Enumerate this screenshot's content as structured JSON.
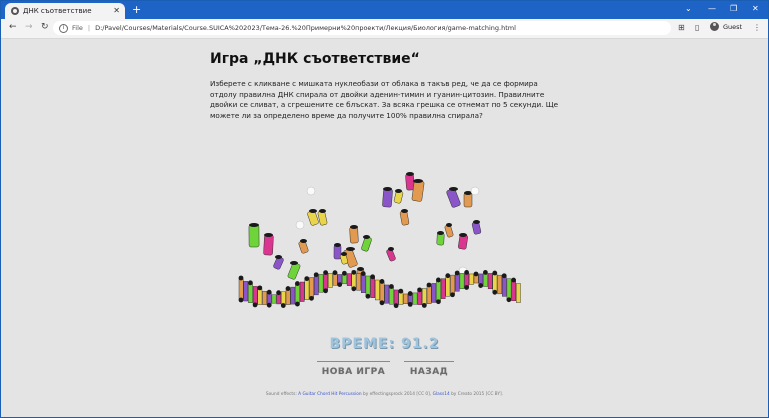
{
  "browser": {
    "tab_title": "ДНК съответствие",
    "tab_close": "✕",
    "new_tab": "+",
    "file_label": "File",
    "url": "D:/Pavel/Courses/Materials/Course.SUICA%202023/Тема-26.%20Примерни%20проекти/Лекция/Биология/game-matching.html",
    "profile": "Guest",
    "back": "←",
    "forward": "→",
    "reload": "↻",
    "minimize": "—",
    "maximize": "❐",
    "close": "✕",
    "chevron": "⌄"
  },
  "page": {
    "title": "Игра „ДНК съответствие“",
    "description": "Изберете с кликване с мишката нуклеобази от облака в такъв ред, че да се формира отдолу правилна ДНК спирала от двойки аденин-тимин и гуанин-цитозин. Правилните двойки се сливат, а сгрешените се блъскат. За всяка грешка се отнемат по 5 секунди. Ще можете ли за определено време да получите 100% правилна спирала?",
    "timer": "ВРЕМЕ: 91.2",
    "new_game": "НОВА ИГРА",
    "back": "НАЗАД",
    "credits_prefix": "Sound effects:",
    "credits_link1": "A Guitar Chord Hit Percussion",
    "credits_mid": "by effectingsprock 2014 [CC 0],",
    "credits_link2": "Glass14",
    "credits_suffix": "by Creato 2015 [CC BY]."
  },
  "colors": {
    "titlebar": "#1e63c6",
    "timer": "#9fc4de",
    "cylinder_orange": "#e19a4f",
    "cylinder_purple": "#8a55c8",
    "cylinder_green": "#6fd43a",
    "cylinder_pink": "#d8368f",
    "cylinder_yellow": "#e9d44a",
    "cap_black": "#1a1a1a"
  }
}
